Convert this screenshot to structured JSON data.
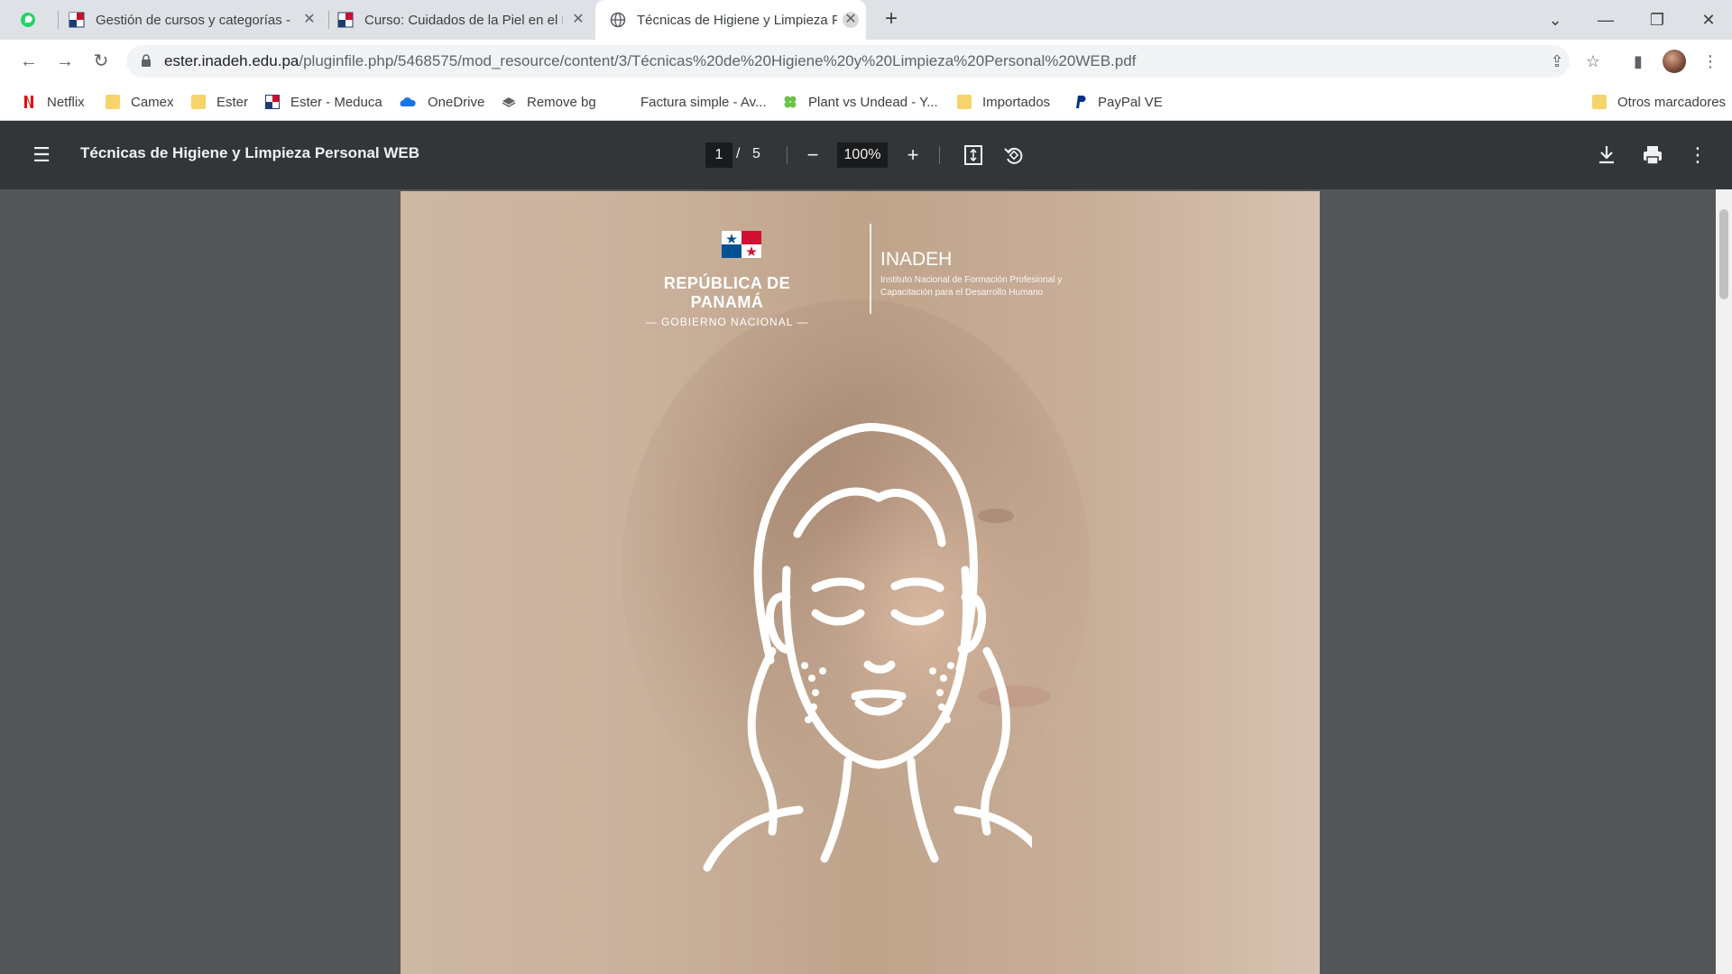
{
  "tabs": [
    {
      "label": "Gestión de cursos y categorías - ",
      "icon": "inadeh-favicon"
    },
    {
      "label": "Curso: Cuidados de la Piel en el F",
      "icon": "inadeh-favicon"
    },
    {
      "label": "Técnicas de Higiene y Limpieza P",
      "icon": "globe-icon",
      "active": true
    }
  ],
  "address": {
    "domain": "ester.inadeh.edu.pa",
    "path": "/pluginfile.php/5468575/mod_resource/content/3/Técnicas%20de%20Higiene%20y%20Limpieza%20Personal%20WEB.pdf"
  },
  "bookmarks": [
    {
      "label": "Netflix",
      "icon": "netflix-icon"
    },
    {
      "label": "Camex",
      "icon": "folder-icon"
    },
    {
      "label": "Ester",
      "icon": "folder-icon"
    },
    {
      "label": "Ester - Meduca",
      "icon": "inadeh-favicon"
    },
    {
      "label": "OneDrive",
      "icon": "onedrive-icon"
    },
    {
      "label": "Remove bg",
      "icon": "removebg-icon"
    },
    {
      "label": "Factura simple - Av...",
      "icon": "blank"
    },
    {
      "label": "Plant vs Undead - Y...",
      "icon": "clover-icon"
    },
    {
      "label": "Importados",
      "icon": "folder-icon"
    },
    {
      "label": "PayPal VE",
      "icon": "paypal-icon"
    },
    {
      "label": "Otros marcadores",
      "icon": "folder-icon"
    }
  ],
  "pdf": {
    "title": "Técnicas de Higiene y Limpieza Personal WEB",
    "page_current": "1",
    "page_sep": "/",
    "page_total": "5",
    "zoom": "100%"
  },
  "cover": {
    "gov_title": "REPÚBLICA DE PANAMÁ",
    "gov_subtitle": "— GOBIERNO NACIONAL —",
    "inst_title": "INADEH",
    "inst_subtitle": "Instituto Nacional de Formación Profesional y Capacitación para el Desarrollo Humano"
  },
  "colors": {
    "tabstrip": "#dee1e6",
    "pdf_toolbar": "#323639",
    "viewer_bg": "#525659"
  }
}
